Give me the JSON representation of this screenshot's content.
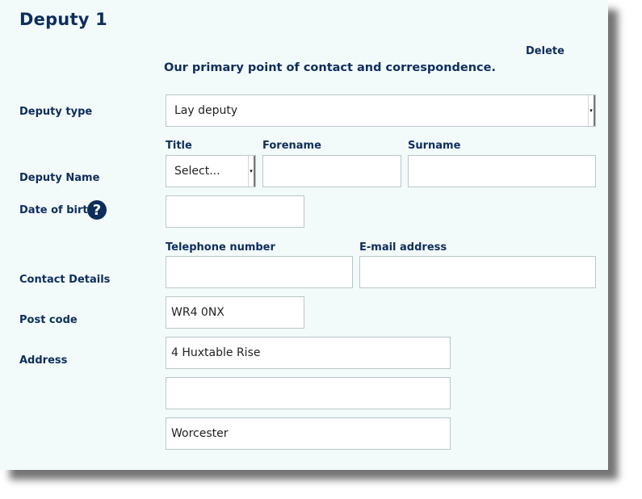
{
  "header": {
    "title": "Deputy 1",
    "delete_label": "Delete",
    "subtitle": "Our primary point of contact and correspondence."
  },
  "deputy_type": {
    "label": "Deputy type",
    "selected": "Lay deputy"
  },
  "deputy_name": {
    "label": "Deputy Name",
    "title_label": "Title",
    "title_selected": "Select...",
    "forename_label": "Forename",
    "forename_value": "",
    "surname_label": "Surname",
    "surname_value": ""
  },
  "date_of_birth": {
    "label": "Date of birth",
    "help_icon": "question-circle-icon",
    "value": ""
  },
  "contact": {
    "label": "Contact Details",
    "telephone_label": "Telephone number",
    "telephone_value": "",
    "email_label": "E-mail address",
    "email_value": ""
  },
  "post_code": {
    "label": "Post code",
    "value": "WR4 0NX"
  },
  "address": {
    "label": "Address",
    "line1": "4 Huxtable Rise",
    "line2": "",
    "line3": "Worcester"
  },
  "colors": {
    "panel_bg": "#f3fafa",
    "text_navy": "#0d2e5c",
    "field_border": "#b9c6c9"
  }
}
